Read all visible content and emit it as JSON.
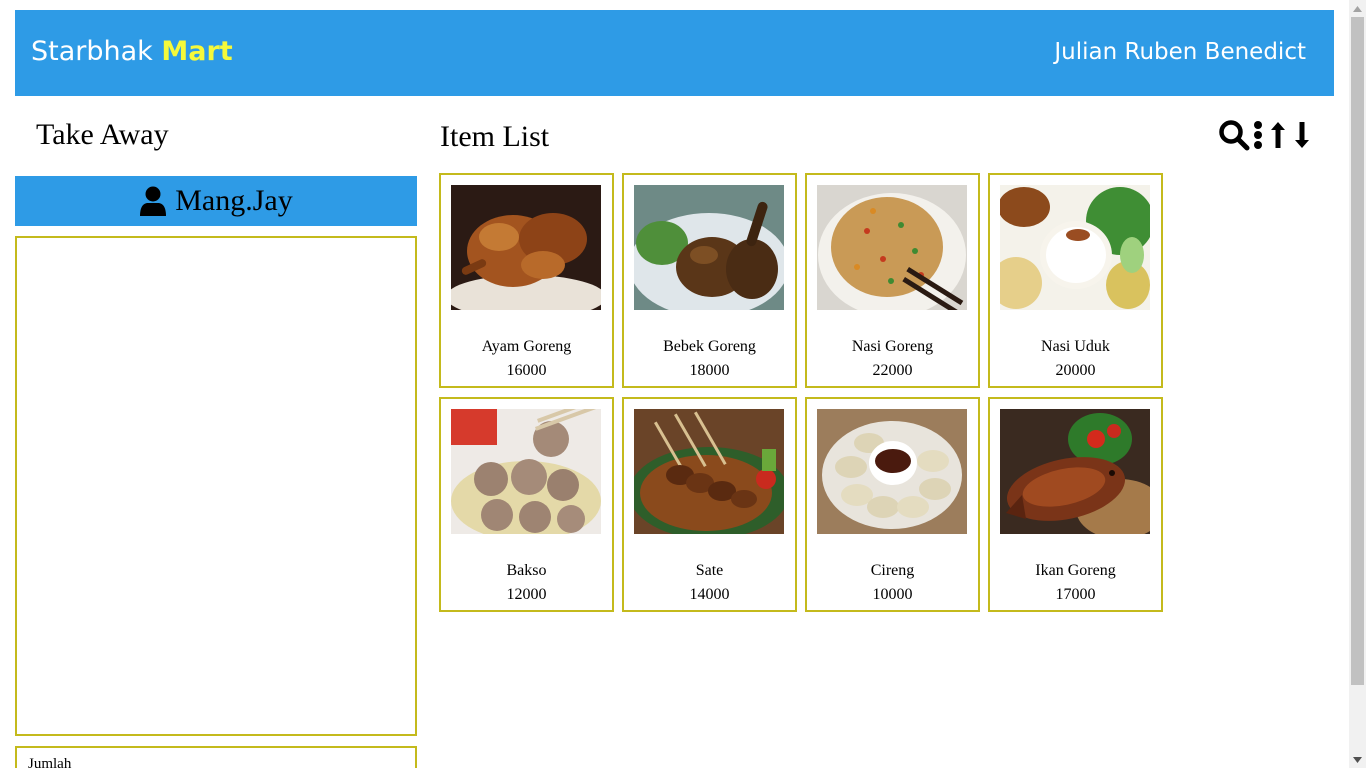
{
  "header": {
    "brand_main": "Starbhak",
    "brand_accent": "Mart",
    "user_name": "Julian Ruben Benedict"
  },
  "left": {
    "title": "Take Away",
    "customer": "Mang.Jay",
    "total_label": "Jumlah"
  },
  "right": {
    "title": "Item List",
    "tools": [
      "search-icon",
      "more-vertical-icon",
      "sort-ascending-icon",
      "sort-descending-icon"
    ]
  },
  "items": [
    {
      "name": "Ayam Goreng",
      "price": "16000"
    },
    {
      "name": "Bebek Goreng",
      "price": "18000"
    },
    {
      "name": "Nasi Goreng",
      "price": "22000"
    },
    {
      "name": "Nasi Uduk",
      "price": "20000"
    },
    {
      "name": "Bakso",
      "price": "12000"
    },
    {
      "name": "Sate",
      "price": "14000"
    },
    {
      "name": "Cireng",
      "price": "10000"
    },
    {
      "name": "Ikan Goreng",
      "price": "17000"
    }
  ],
  "colors": {
    "primary": "#2e9be6",
    "accent": "#f5f93a",
    "card_border": "#c4ba1c"
  }
}
